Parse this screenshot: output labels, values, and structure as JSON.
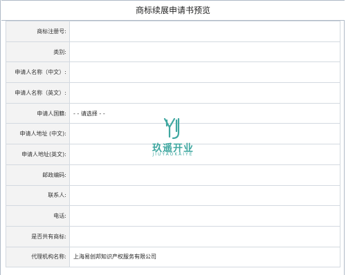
{
  "page": {
    "title": "商标续展申请书预览"
  },
  "form": {
    "rows": [
      {
        "label": "商标注册号:",
        "value": ""
      },
      {
        "label": "类别:",
        "value": ""
      },
      {
        "label": "申请人名称（中文）:",
        "value": ""
      },
      {
        "label": "申请人名称（英文）:",
        "value": ""
      },
      {
        "label": "申请人国籍:",
        "value": "- - 请选择 - -"
      },
      {
        "label": "申请人地址 (中文):",
        "value": ""
      },
      {
        "label": "申请人地址(英文):",
        "value": ""
      },
      {
        "label": "邮政编码:",
        "value": ""
      },
      {
        "label": "联系人:",
        "value": ""
      },
      {
        "label": "电话:",
        "value": ""
      },
      {
        "label": "是否共有商标:",
        "value": ""
      },
      {
        "label": "代理机构名称:",
        "value": "上海易创邦知识产权服务有限公司"
      }
    ]
  },
  "watermark": {
    "logo_icon": "jy-logo-icon",
    "text_cn": "玖遥开业",
    "text_en": "JIUYAOKAIYE",
    "color": "#3fa7a0"
  }
}
